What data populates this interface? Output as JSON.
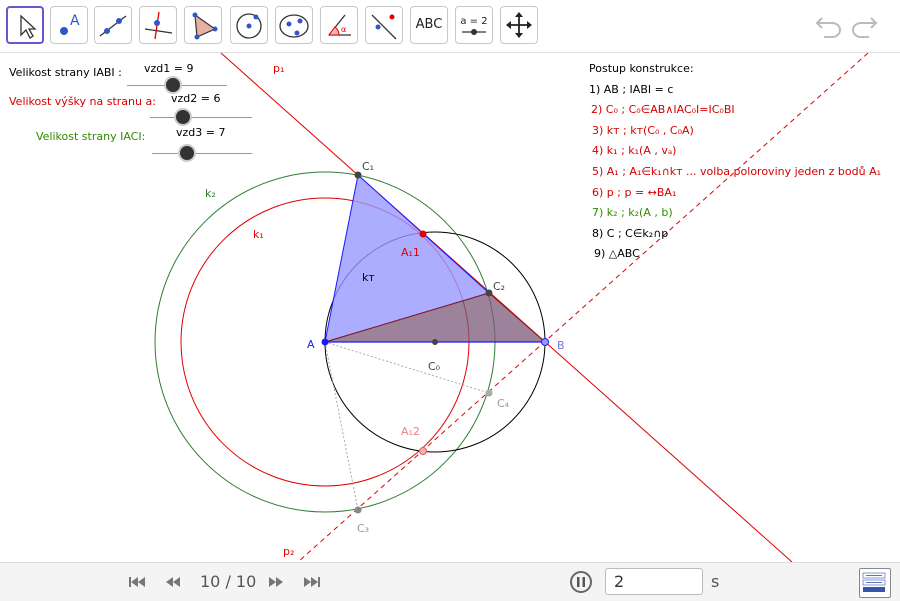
{
  "toolbar": {
    "tools": [
      "move-tool",
      "point-tool",
      "line-tool",
      "perpendicular-line-tool",
      "polygon-tool",
      "circle-center-point-tool",
      "ellipse-tool",
      "angle-tool",
      "reflect-tool",
      "text-tool",
      "slider-tool",
      "move-graphics-view-tool"
    ],
    "text_tool_label": "ABC",
    "slider_tool_label": "a = 2"
  },
  "sliders": [
    {
      "label": "Velikost strany IABI :",
      "value_text": "vzd1 = 9",
      "label_color": "#000000"
    },
    {
      "label": "Velikost výšky na stranu a:",
      "value_text": "vzd2 = 6",
      "label_color": "#d40000"
    },
    {
      "label": "Velikost strany IACI:",
      "value_text": "vzd3 = 7",
      "label_color": "#2e8b00"
    }
  ],
  "construction": {
    "title": "Postup konstrukce:",
    "steps": [
      {
        "text": "1) AB ; IABI = c",
        "color": "#000000"
      },
      {
        "text": "2) C₀ ; C₀∈AB∧IAC₀I=IC₀BI",
        "color": "#d40000"
      },
      {
        "text": "3) kт ; kт(C₀ , C₀A)",
        "color": "#d40000"
      },
      {
        "text": "4) k₁ ; k₁(A , vₐ)",
        "color": "#d40000"
      },
      {
        "text": "5) A₁ ; A₁∈k₁∩kт ... volba poloroviny jeden z bodů A₁",
        "color": "#d40000"
      },
      {
        "text": "6) p ; p = ↔BA₁",
        "color": "#d40000"
      },
      {
        "text": "7) k₂ ; k₂(A , b)",
        "color": "#2e8b00"
      },
      {
        "text": "8) C ; C∈k₂∩p",
        "color": "#000000"
      },
      {
        "text": "9) △ABC",
        "color": "#000000"
      }
    ]
  },
  "figure": {
    "labels": {
      "A": "A",
      "B": "B",
      "C0": "C₀",
      "C1": "C₁",
      "C2": "C₂",
      "C3": "C₃",
      "C4": "C₄",
      "A1_1": "A₁1",
      "A1_2": "A₁2",
      "k1": "k₁",
      "k2": "k₂",
      "kt": "kт",
      "p1": "p₁",
      "p2": "p₂"
    },
    "colors": {
      "red": "#e00000",
      "green": "#2e7d32",
      "blue": "#1a1aff",
      "fill_blue": "#9999ff",
      "fill_purple": "#9b6b8e",
      "gray": "#999999"
    }
  },
  "player": {
    "step_indicator": "10 / 10",
    "speed_value": "2",
    "seconds_unit": "s"
  }
}
